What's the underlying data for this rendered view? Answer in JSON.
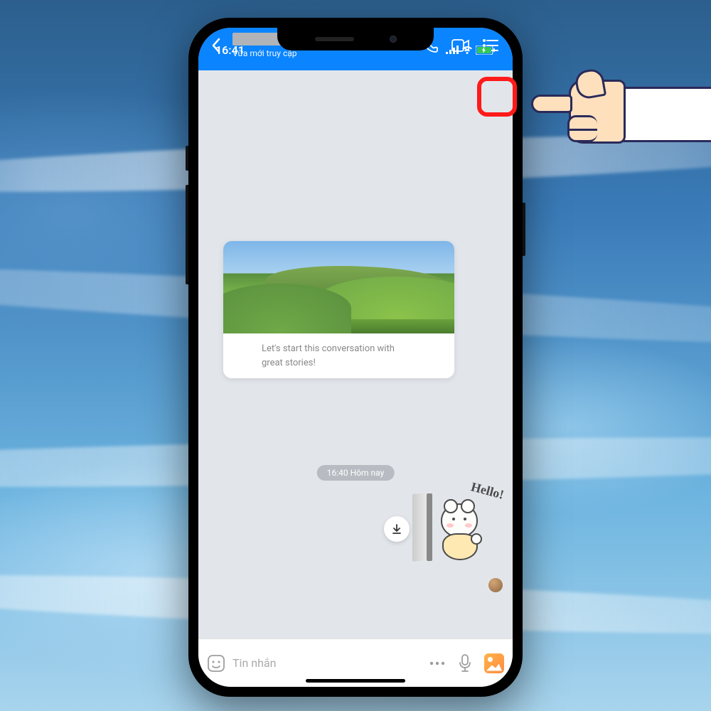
{
  "statusbar": {
    "time": "16:41",
    "signal_icon": "signal-icon",
    "wifi_icon": "wifi-icon",
    "battery_icon": "battery-charging-icon"
  },
  "header": {
    "back_icon": "chevron-left-icon",
    "contact_status": "Vừa mới truy cập",
    "call_icon": "phone-icon",
    "video_icon": "video-icon",
    "menu_icon": "list-menu-icon"
  },
  "card": {
    "text_line1": "Let's start this conversation with",
    "text_line2": "great stories!"
  },
  "chat": {
    "timestamp": "16:40 Hôm nay",
    "sticker_hello": "Hello!",
    "download_icon": "download-icon"
  },
  "inputbar": {
    "sticker_icon": "sticker-smile-icon",
    "placeholder": "Tin nhắn",
    "more_icon": "more-horizontal-icon",
    "mic_icon": "microphone-icon",
    "gallery_icon": "gallery-icon"
  },
  "annotation": {
    "highlight_target": "menu-button",
    "pointer": "pointing-hand"
  }
}
